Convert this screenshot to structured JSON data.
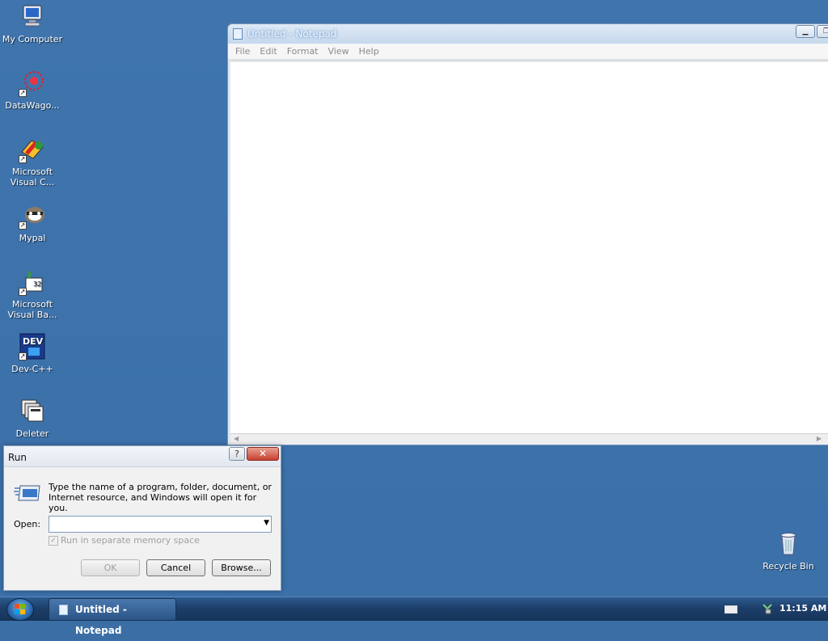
{
  "desktop": {
    "icons": [
      {
        "label": "My Computer",
        "icon": "computer-icon"
      },
      {
        "label": "DataWago...",
        "icon": "datawagon-icon"
      },
      {
        "label": "Microsoft Visual C...",
        "icon": "visual-cpp-icon"
      },
      {
        "label": "Mypal",
        "icon": "mypal-icon"
      },
      {
        "label": "Microsoft Visual Ba...",
        "icon": "visual-basic-icon"
      },
      {
        "label": "Dev-C++",
        "icon": "devcpp-icon"
      },
      {
        "label": "Deleter",
        "icon": "deleter-icon"
      },
      {
        "label": "Recycle Bin",
        "icon": "recycle-bin-icon"
      }
    ]
  },
  "notepad": {
    "title": "Untitled - Notepad",
    "menu": [
      "File",
      "Edit",
      "Format",
      "View",
      "Help"
    ],
    "content": ""
  },
  "run_dialog": {
    "title": "Run",
    "help_label": "?",
    "close_label": "✕",
    "description": "Type the name of a program, folder, document, or Internet resource, and Windows will open it for you.",
    "open_label": "Open:",
    "open_value": "",
    "separate_memory_label": "Run in separate memory space",
    "separate_memory_checked": true,
    "ok_label": "OK",
    "cancel_label": "Cancel",
    "browse_label": "Browse..."
  },
  "taskbar": {
    "task_label": "Untitled - Notepad",
    "clock": "11:15 AM"
  },
  "colors": {
    "desktop": "#3b70a9",
    "taskbar": "#1d3f6a"
  }
}
